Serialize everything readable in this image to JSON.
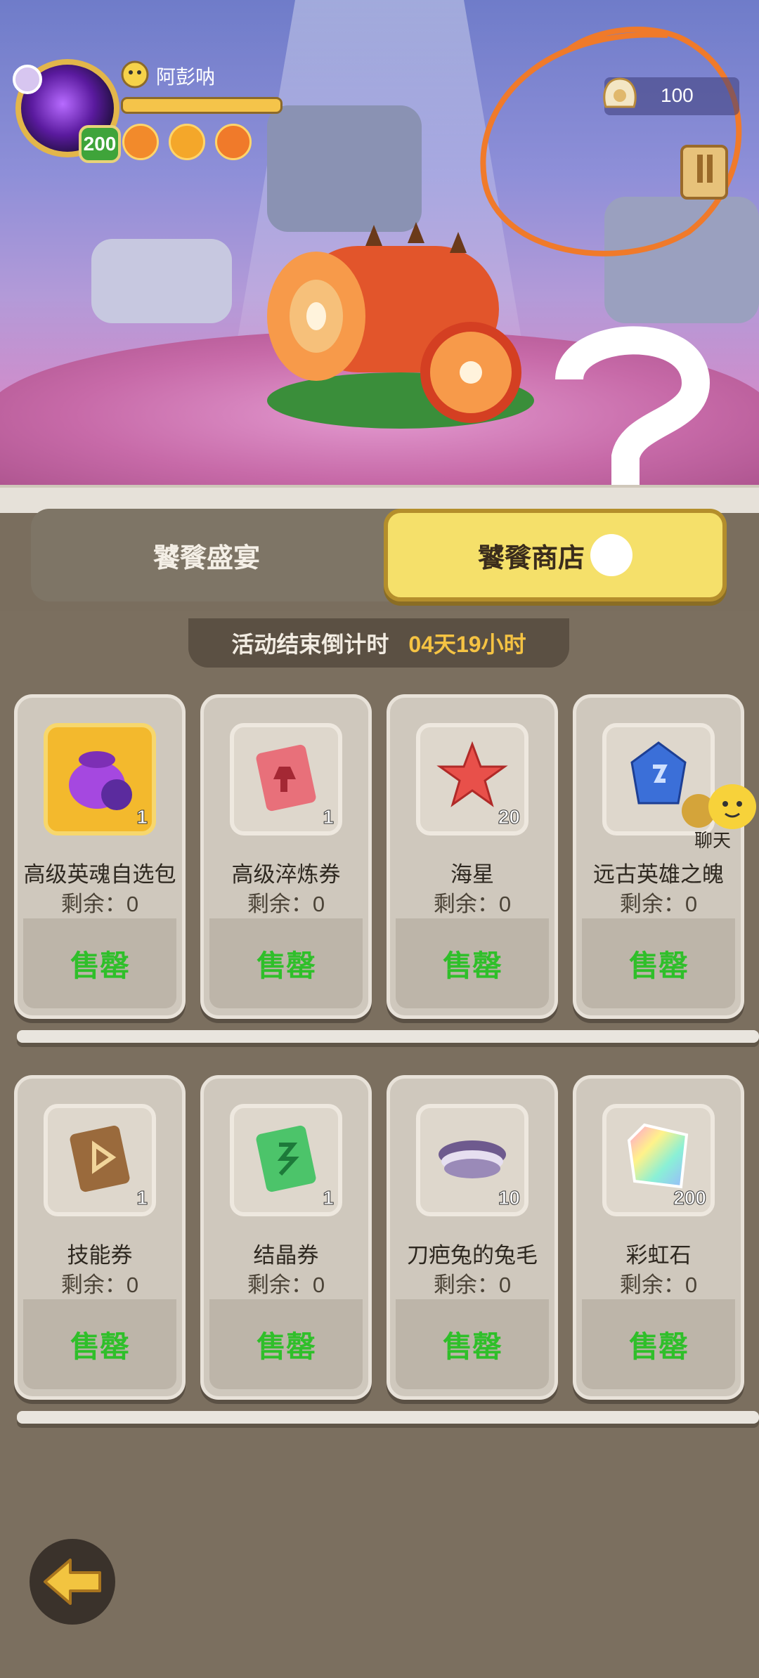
{
  "player": {
    "name": "阿彭呐",
    "level": "200"
  },
  "currency": {
    "amount": "100",
    "icon": "shell-icon"
  },
  "tabs": [
    {
      "label": "饕餮盛宴",
      "active": false
    },
    {
      "label": "饕餮商店",
      "active": true
    }
  ],
  "countdown": {
    "label": "活动结束倒计时",
    "value": "04天19小时"
  },
  "items": [
    {
      "name": "高级英魂自选包",
      "qty": "1",
      "remain": "剩余：0",
      "status": "售罄",
      "icon": "soul-bag-icon"
    },
    {
      "name": "高级淬炼券",
      "qty": "1",
      "remain": "剩余：0",
      "status": "售罄",
      "icon": "red-ticket-icon"
    },
    {
      "name": "海星",
      "qty": "20",
      "remain": "剩余：0",
      "status": "售罄",
      "icon": "starfish-icon"
    },
    {
      "name": "远古英雄之魄",
      "qty": "",
      "remain": "剩余：0",
      "status": "售罄",
      "icon": "blue-crystal-icon"
    },
    {
      "name": "技能券",
      "qty": "1",
      "remain": "剩余：0",
      "status": "售罄",
      "icon": "skill-ticket-icon"
    },
    {
      "name": "结晶券",
      "qty": "1",
      "remain": "剩余：0",
      "status": "售罄",
      "icon": "green-ticket-icon"
    },
    {
      "name": "刀疤兔的兔毛",
      "qty": "10",
      "remain": "剩余：0",
      "status": "售罄",
      "icon": "rabbit-fur-icon"
    },
    {
      "name": "彩虹石",
      "qty": "200",
      "remain": "剩余：0",
      "status": "售罄",
      "icon": "rainbow-stone-icon"
    }
  ],
  "chat": {
    "label": "聊天"
  },
  "colors": {
    "tab_active": "#f5e06a",
    "sold_out": "#2fbf2a",
    "countdown_value": "#f5c343",
    "bg": "#7b6f5f"
  }
}
